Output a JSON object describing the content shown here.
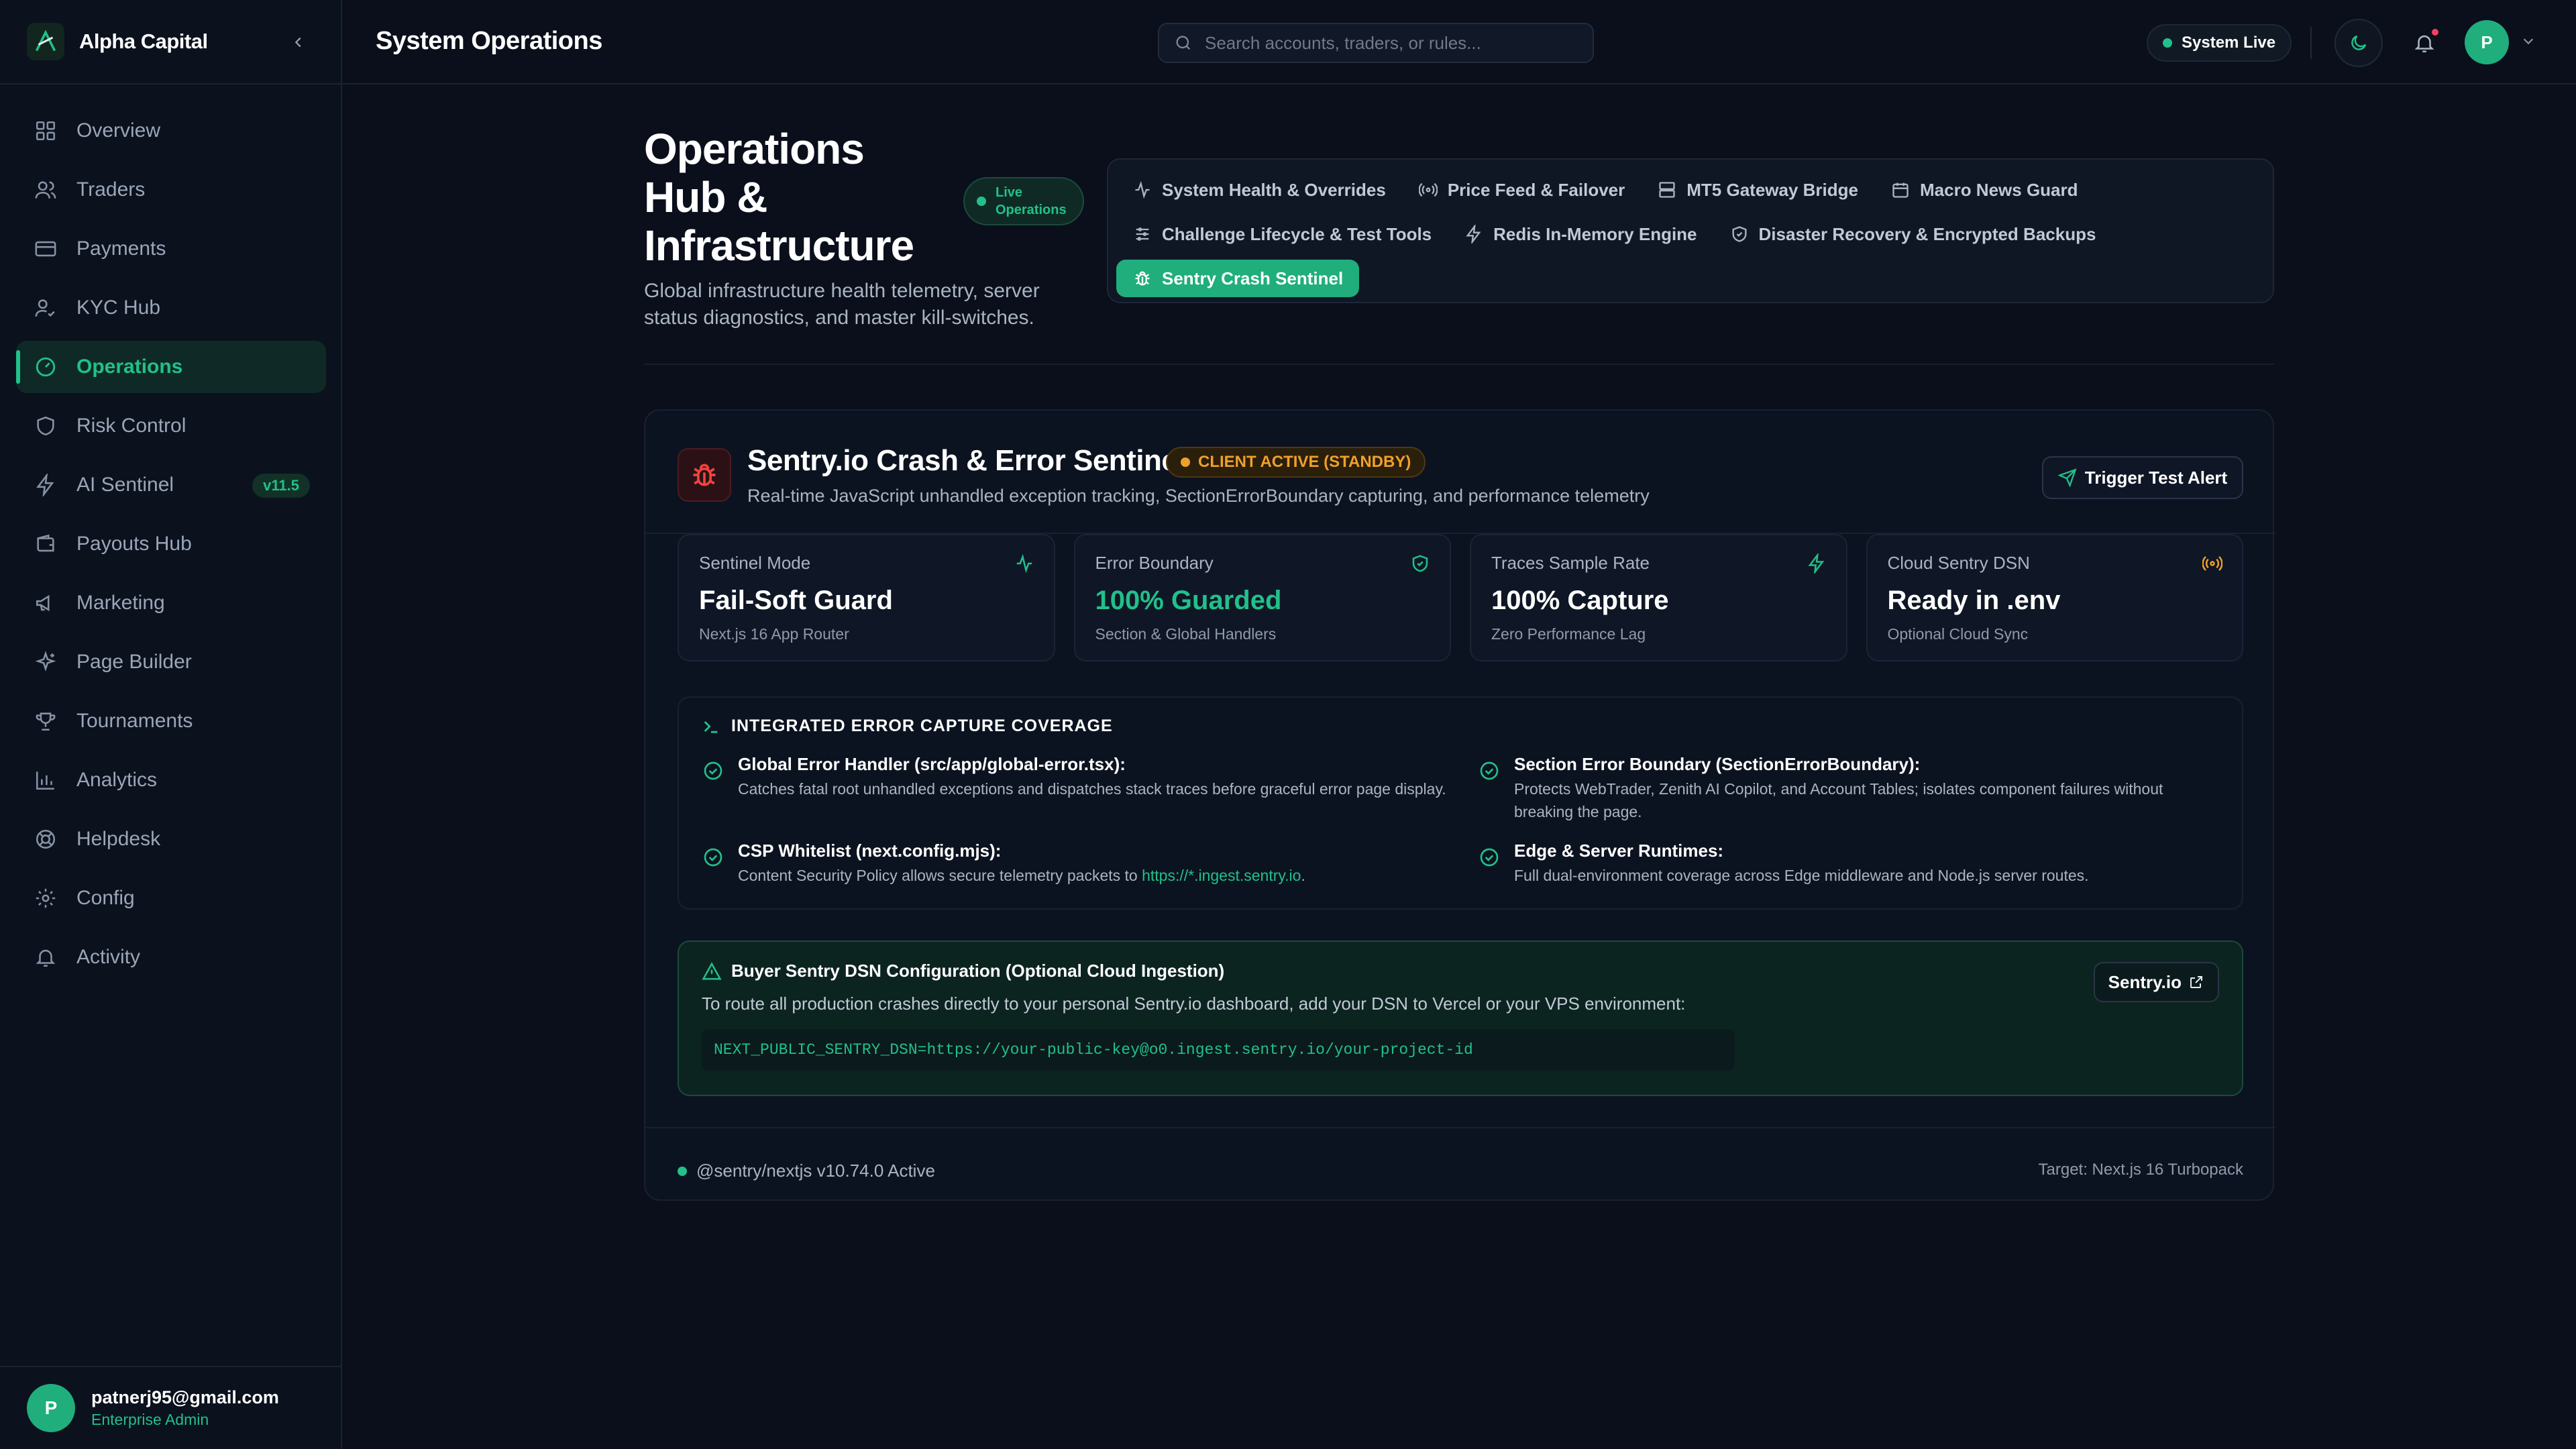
{
  "brand": {
    "name": "Alpha Capital"
  },
  "sidebar": {
    "items": [
      {
        "label": "Overview",
        "icon": "grid-icon"
      },
      {
        "label": "Traders",
        "icon": "users-icon"
      },
      {
        "label": "Payments",
        "icon": "credit-card-icon"
      },
      {
        "label": "KYC Hub",
        "icon": "user-check-icon"
      },
      {
        "label": "Operations",
        "icon": "gauge-icon",
        "active": true
      },
      {
        "label": "Risk Control",
        "icon": "shield-icon"
      },
      {
        "label": "AI Sentinel",
        "icon": "zap-icon",
        "badge": "v11.5"
      },
      {
        "label": "Payouts Hub",
        "icon": "wallet-icon"
      },
      {
        "label": "Marketing",
        "icon": "megaphone-icon"
      },
      {
        "label": "Page Builder",
        "icon": "sparkles-icon"
      },
      {
        "label": "Tournaments",
        "icon": "trophy-icon"
      },
      {
        "label": "Analytics",
        "icon": "bar-chart-icon"
      },
      {
        "label": "Helpdesk",
        "icon": "lifebuoy-icon"
      },
      {
        "label": "Config",
        "icon": "gear-icon"
      },
      {
        "label": "Activity",
        "icon": "bell-icon"
      }
    ],
    "user": {
      "initial": "P",
      "email": "patnerj95@gmail.com",
      "role": "Enterprise Admin"
    }
  },
  "header": {
    "title": "System Operations",
    "search_placeholder": "Search accounts, traders, or rules...",
    "status": "System Live",
    "avatar_initial": "P"
  },
  "hero": {
    "title": "Operations Hub & Infrastructure",
    "badge": "Live Operations",
    "subtitle": "Global infrastructure health telemetry, server status diagnostics, and master kill-switches."
  },
  "tabs": [
    {
      "label": "System Health & Overrides",
      "icon": "activity-icon"
    },
    {
      "label": "Price Feed & Failover",
      "icon": "radio-icon"
    },
    {
      "label": "MT5 Gateway Bridge",
      "icon": "server-icon"
    },
    {
      "label": "Macro News Guard",
      "icon": "calendar-icon"
    },
    {
      "label": "Challenge Lifecycle & Test Tools",
      "icon": "sliders-icon"
    },
    {
      "label": "Redis In-Memory Engine",
      "icon": "zap-icon"
    },
    {
      "label": "Disaster Recovery & Encrypted Backups",
      "icon": "shield-check-icon"
    },
    {
      "label": "Sentry Crash Sentinel",
      "icon": "bug-icon",
      "active": true
    }
  ],
  "card": {
    "title": "Sentry.io Crash & Error Sentinel",
    "status": "CLIENT ACTIVE (STANDBY)",
    "description": "Real-time JavaScript unhandled exception tracking, SectionErrorBoundary capturing, and performance telemetry",
    "trigger_label": "Trigger Test Alert",
    "stats": [
      {
        "label": "Sentinel Mode",
        "value": "Fail-Soft Guard",
        "sub": "Next.js 16 App Router",
        "icon": "activity-icon"
      },
      {
        "label": "Error Boundary",
        "value": "100% Guarded",
        "sub": "Section & Global Handlers",
        "icon": "shield-check-icon"
      },
      {
        "label": "Traces Sample Rate",
        "value": "100% Capture",
        "sub": "Zero Performance Lag",
        "icon": "zap-icon"
      },
      {
        "label": "Cloud Sentry DSN",
        "value": "Ready in .env",
        "sub": "Optional Cloud Sync",
        "icon": "radio-icon"
      }
    ],
    "coverage": {
      "title": "INTEGRATED ERROR CAPTURE COVERAGE",
      "items": [
        {
          "title": "Global Error Handler (src/app/global-error.tsx):",
          "desc": "Catches fatal root unhandled exceptions and dispatches stack traces before graceful error page display."
        },
        {
          "title": "Section Error Boundary (SectionErrorBoundary):",
          "desc": "Protects WebTrader, Zenith AI Copilot, and Account Tables; isolates component failures without breaking the page."
        },
        {
          "title": "CSP Whitelist (next.config.mjs):",
          "desc": "Content Security Policy allows secure telemetry packets to ",
          "link": "https://*.ingest.sentry.io",
          "desc_end": "."
        },
        {
          "title": "Edge & Server Runtimes:",
          "desc": "Full dual-environment coverage across Edge middleware and Node.js server routes."
        }
      ]
    },
    "dsn": {
      "title": "Buyer Sentry DSN Configuration (Optional Cloud Ingestion)",
      "desc": "To route all production crashes directly to your personal Sentry.io dashboard, add your DSN to Vercel or your VPS environment:",
      "code": "NEXT_PUBLIC_SENTRY_DSN=https://your-public-key@o0.ingest.sentry.io/your-project-id",
      "button": "Sentry.io"
    },
    "footer": {
      "left": "@sentry/nextjs v10.74.0 Active",
      "right": "Target: Next.js 16 Turbopack"
    }
  },
  "colors": {
    "accent": "#22c08a",
    "warning": "#f0a02a",
    "danger": "#f43f5e",
    "background": "#0a0f1b"
  }
}
